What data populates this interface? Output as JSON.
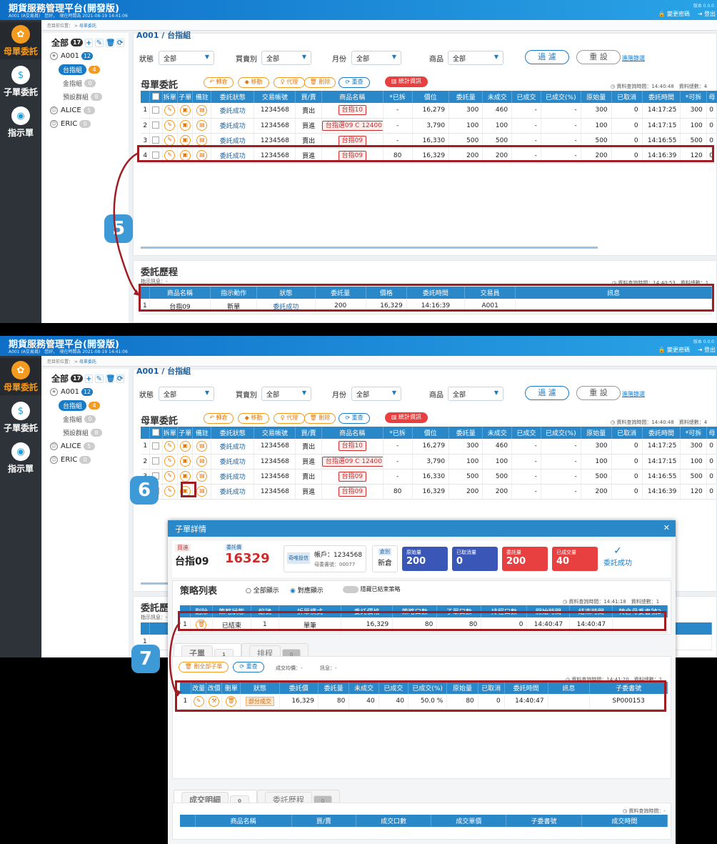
{
  "app": {
    "title": "期貨服務管理平台(開發版)",
    "user": "A001 (A交易員)",
    "greeting": "您好，",
    "login_time": "現在時間為 2021-08-19 14:41:06",
    "version": "版本 0.0.0",
    "change_password": "變更密碼",
    "logout": "登出"
  },
  "nav": [
    {
      "label": "母單委託",
      "icon": "tree-icon"
    },
    {
      "label": "子單委託",
      "icon": "money-hand-icon"
    },
    {
      "label": "指示單",
      "icon": "bulb-icon"
    }
  ],
  "breadcrumb": {
    "prefix": "您目前位置：",
    "sep": ">",
    "current": "母單委託"
  },
  "tree": {
    "root": {
      "label": "全部",
      "count": "17"
    },
    "a001": {
      "label": "A001",
      "count": "12"
    },
    "sub": [
      {
        "label": "台指組",
        "count": "4"
      },
      {
        "label": "金指組",
        "count": "0"
      },
      {
        "label": "預設群組",
        "count": "8"
      }
    ],
    "alice": {
      "label": "ALICE",
      "count": "5"
    },
    "eric": {
      "label": "ERIC",
      "count": "0"
    }
  },
  "cut_header": "A001 / 台指組",
  "filters": {
    "status_label": "狀態",
    "status_value": "全部",
    "bs_label": "買賣別",
    "bs_value": "全部",
    "month_label": "月份",
    "month_value": "全部",
    "product_label": "商品",
    "product_value": "全部",
    "filter_btn": "過 濾",
    "reset_btn": "重 設",
    "advanced": "進階篩選"
  },
  "parent": {
    "title": "母單委託",
    "actions": [
      "轉倉",
      "移動",
      "代理",
      "刪除",
      "重查"
    ],
    "stats_btn": "統計資訊",
    "query_time": "資料查詢時間：14:40:48",
    "total": "資料總數：4",
    "columns": [
      "拆單",
      "子單",
      "備註",
      "委託狀態",
      "交易帳號",
      "買/賣",
      "商品名稱",
      "*已拆",
      "價位",
      "委託量",
      "未成交",
      "已成交",
      "已成交(%)",
      "原始量",
      "已取消",
      "委託時間",
      "*可拆",
      "母"
    ],
    "rows": [
      [
        "1",
        "委託成功",
        "1234568",
        "賣出",
        "台指10",
        "-",
        "16,279",
        "300",
        "460",
        "-",
        "-",
        "300",
        "0",
        "14:17:25",
        "300",
        "0"
      ],
      [
        "2",
        "委託成功",
        "1234568",
        "買進",
        "台指選09 C 12400",
        "-",
        "3,790",
        "100",
        "100",
        "-",
        "-",
        "100",
        "0",
        "14:17:15",
        "100",
        "0"
      ],
      [
        "3",
        "委託成功",
        "1234568",
        "賣出",
        "台指09",
        "-",
        "16,330",
        "500",
        "500",
        "-",
        "-",
        "500",
        "0",
        "14:16:55",
        "500",
        "0"
      ],
      [
        "4",
        "委託成功",
        "1234568",
        "買進",
        "台指09",
        "80",
        "16,329",
        "200",
        "200",
        "-",
        "-",
        "200",
        "0",
        "14:16:39",
        "120",
        "0"
      ]
    ]
  },
  "history": {
    "title": "委託歷程",
    "sub": "指示訊息：-",
    "query_time": "資料查詢時間：14:40:53",
    "total": "資料總數：1",
    "columns": [
      "商品名稱",
      "指示動作",
      "狀態",
      "委託量",
      "價格",
      "委託時間",
      "交易員",
      "訊息"
    ],
    "row": [
      "1",
      "台指09",
      "新單",
      "委託成功",
      "200",
      "16,329",
      "14:16:39",
      "A001",
      ""
    ]
  },
  "steps": {
    "s5": "5",
    "s6": "6",
    "s7": "7"
  },
  "modal": {
    "title": "子單詳情",
    "side": "買進",
    "product": "台指09",
    "price_label": "委託價",
    "price": "16329",
    "type": "奇唯投信",
    "account": "帳戶：1234568",
    "parent_no": "母委書號：00077",
    "kind_label": "倉別",
    "kind": "新倉",
    "stats": [
      {
        "k": "原始量",
        "v": "200",
        "color": "#3a57b8"
      },
      {
        "k": "已取消量",
        "v": "0",
        "color": "#3a57b8"
      },
      {
        "k": "委託量",
        "v": "200",
        "color": "#e84040"
      },
      {
        "k": "已成交量",
        "v": "40",
        "color": "#e84040"
      }
    ],
    "status": "委託成功",
    "strategy": {
      "title": "策略列表",
      "opt_all": "全部顯示",
      "opt_match": "對應顯示",
      "hide_done": "隱藏已結束策略",
      "query_time": "資料查詢時間：14:41:18",
      "total": "資料總數：1",
      "columns": [
        "刪除",
        "策略狀態",
        "編號",
        "拆單模式",
        "委託價格",
        "策略口數",
        "子單口數",
        "排程口數",
        "開始時間",
        "結束時間",
        "轉倉母委書號2"
      ],
      "row": [
        "1",
        "已結束",
        "1",
        "單筆",
        "16,329",
        "80",
        "80",
        "0",
        "14:40:47",
        "14:40:47",
        ""
      ]
    },
    "child_tabs": [
      {
        "label": "子單",
        "count": "1"
      },
      {
        "label": "排程",
        "count": "0"
      }
    ],
    "child": {
      "del_all": "刪全部子單",
      "recheck": "重查",
      "avg": "成交均價：-",
      "msg": "訊息：-",
      "query_time": "資料查詢時間：14:41:20",
      "total": "資料總數：1",
      "columns": [
        "改量",
        "改價",
        "刪單",
        "狀態",
        "委託價",
        "委託量",
        "未成交",
        "已成交",
        "已成交(%)",
        "原始量",
        "已取消",
        "委託時間",
        "訊息",
        "子委書號"
      ],
      "row": [
        "1",
        "部分成交",
        "16,329",
        "80",
        "40",
        "40",
        "50.0 %",
        "80",
        "0",
        "14:40:47",
        "",
        "SP000153"
      ]
    },
    "bottom_tabs": [
      {
        "label": "成交明細",
        "count": "0"
      },
      {
        "label": "委託歷程",
        "count": "0"
      }
    ],
    "fills": {
      "query_time": "資料查詢時間：-",
      "columns": [
        "商品名稱",
        "買/賣",
        "成交口數",
        "成交單價",
        "子委書號",
        "成交時間"
      ]
    }
  }
}
